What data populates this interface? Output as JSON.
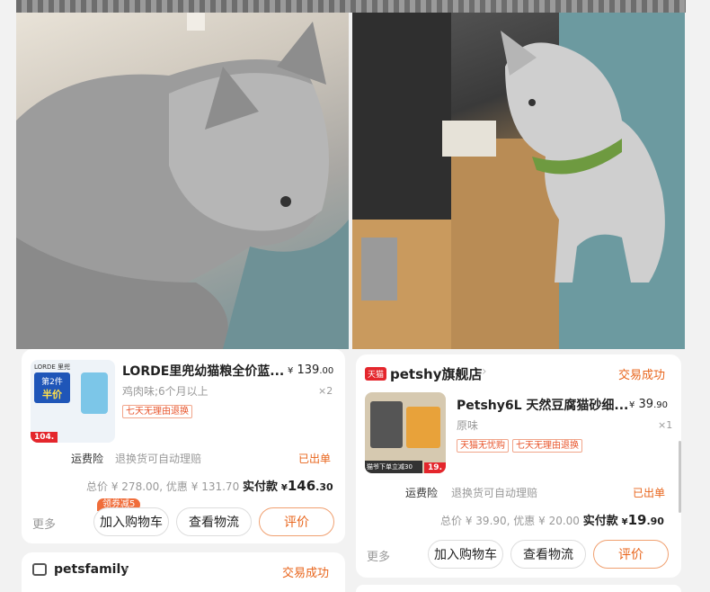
{
  "left_order": {
    "product_title": "LORDE里兜幼猫粮全价蓝...",
    "price_symbol": "¥",
    "price_int": "139",
    "price_dec": ".00",
    "variant": "鸡肉味;6个月以上",
    "quantity": "×2",
    "tags": [
      "七天无理由退换"
    ],
    "thumb_brand": "LORDE 里兜",
    "thumb_promo_line1": "第2件",
    "thumb_promo_line2": "半价",
    "thumb_price": "104.",
    "insurance_label": "运费险",
    "insurance_desc": "退换货可自动理赔",
    "insurance_status": "已出单",
    "summary": {
      "total_label": "总价",
      "total_value": "¥ 278.00",
      "discount_label": "优惠",
      "discount_value": "¥ 131.70",
      "paid_label": "实付款",
      "paid_symbol": "¥",
      "paid_int": "146",
      "paid_dec": ".30"
    },
    "more_label": "更多",
    "add_cart_label": "加入购物车",
    "coupon_badge": "领券减5",
    "logistics_label": "查看物流",
    "review_label": "评价"
  },
  "left_next_store": {
    "store_name": "petsfamily",
    "status": "交易成功"
  },
  "right_order": {
    "tmall_badge": "天猫",
    "store_name": "petshy旗舰店",
    "status": "交易成功",
    "product_title": "Petshy6L 天然豆腐猫砂细...",
    "price_symbol": "¥",
    "price_int": "39",
    "price_dec": ".90",
    "variant": "原味",
    "quantity": "×1",
    "tags": [
      "天猫无忧购",
      "七天无理由退换"
    ],
    "thumb_caption": "猫爷下单立减30",
    "thumb_price": "19.",
    "insurance_label": "运费险",
    "insurance_desc": "退换货可自动理赔",
    "insurance_status": "已出单",
    "summary": {
      "total_label": "总价",
      "total_value": "¥ 39.90",
      "discount_label": "优惠",
      "discount_value": "¥ 20.00",
      "paid_label": "实付款",
      "paid_symbol": "¥",
      "paid_int": "19",
      "paid_dec": ".90"
    },
    "more_label": "更多",
    "add_cart_label": "加入购物车",
    "logistics_label": "查看物流",
    "review_label": "评价"
  },
  "colors": {
    "accent_orange": "#e8651c",
    "tmall_red": "#e4262c",
    "tag_red": "#e8552c"
  }
}
